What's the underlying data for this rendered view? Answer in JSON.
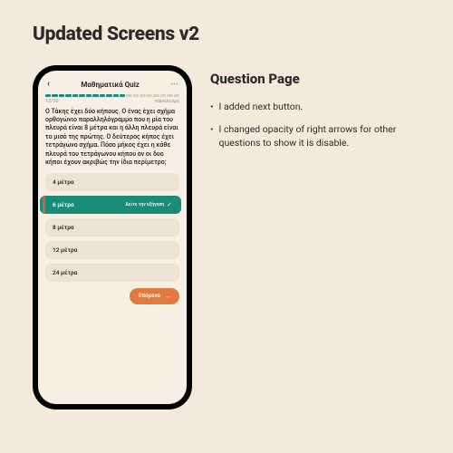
{
  "page": {
    "title": "Updated Screens v2"
  },
  "side": {
    "title": "Question Page",
    "bullets": [
      "I added next button.",
      "I changed opacity of right arrows for other questions to show it is disable."
    ]
  },
  "quiz": {
    "header_title": "Μαθηματικά Quiz",
    "counter": "12/20",
    "skip_label": "παραλειψη",
    "question": "Ο Τάκης έχει δύο κήπους. Ο ένας έχει σχήμα ορθογώνιο παραλληλόγραμμο που η μία του πλευρά είναι 8 μέτρα και η άλλη πλευρά είναι το μισό της πρώτης. Ο δεύτερος κήπος έχει τετράγωνο σχήμα. Πόσο μήκος έχει η κάθε πλευρά του τετράγωνου κήπου αν οι δυο κήποι έχουν ακριβώς την ίδια περίμετρο;",
    "options": [
      "4 μέτρα",
      "6 μέτρα",
      "8 μέτρα",
      "12 μέτρα",
      "24 μέτρα"
    ],
    "selected_index": 1,
    "explanation_label": "Δείτε την εξήγηση",
    "next_label": "Επόμενο",
    "progress_done": 12,
    "progress_total": 20
  }
}
